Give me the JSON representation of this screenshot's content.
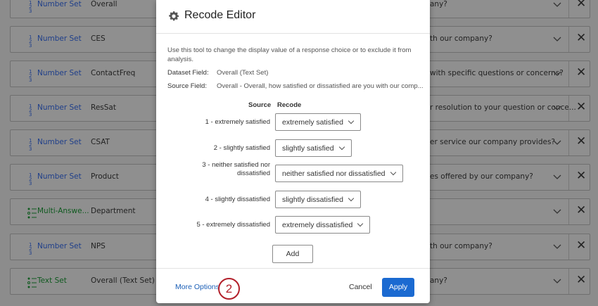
{
  "rows": [
    {
      "type": "Number Set",
      "type_icon": "number-set-icon",
      "field": "Overall",
      "question": "any?",
      "green": false
    },
    {
      "type": "Number Set",
      "type_icon": "number-set-icon",
      "field": "CES",
      "question": "th our company?",
      "green": false
    },
    {
      "type": "Number Set",
      "type_icon": "number-set-icon",
      "field": "ContactFreq",
      "question": "with specific questions or concerns?",
      "green": false
    },
    {
      "type": "Number Set",
      "type_icon": "number-set-icon",
      "field": "ResSat",
      "question": "r resolution to your question or conce...",
      "green": false
    },
    {
      "type": "Number Set",
      "type_icon": "number-set-icon",
      "field": "CSAT",
      "question": "er service our company provides?",
      "green": false
    },
    {
      "type": "Number Set",
      "type_icon": "number-set-icon",
      "field": "Product",
      "question": "es offered by our company?",
      "green": false
    },
    {
      "type": "Multi-Answe...",
      "type_icon": "multi-answer-icon",
      "field": "Department",
      "question": "",
      "green": true
    },
    {
      "type": "Number Set",
      "type_icon": "number-set-icon",
      "field": "NPS",
      "question": "th our company?",
      "green": false
    },
    {
      "type": "Text Set",
      "type_icon": "text-set-icon",
      "field": "Overall (Text Set)",
      "question": "any?",
      "green": true
    }
  ],
  "modal": {
    "title": "Recode Editor",
    "intro": "Use this tool to change the display value of a response choice or to exclude it from analysis.",
    "dataset_label": "Dataset Field:",
    "dataset_value": "Overall (Text Set)",
    "source_label": "Source Field:",
    "source_value": "Overall - Overall, how satisfied or dissatisfied are you with our comp...",
    "col_source": "Source",
    "col_recode": "Recode",
    "recodes": [
      {
        "source": "1 - extremely satisfied",
        "recode": "extremely satisfied"
      },
      {
        "source": "2 - slightly satisfied",
        "recode": "slightly satisfied"
      },
      {
        "source_line1": "3 - neither satisfied nor",
        "source_line2": "dissatisfied",
        "recode": "neither satisfied nor dissatisfied"
      },
      {
        "source": "4 - slightly dissatisfied",
        "recode": "slightly dissatisfied"
      },
      {
        "source": "5 - extremely dissatisfied",
        "recode": "extremely dissatisfied"
      }
    ],
    "add_label": "Add",
    "more_options": "More Options",
    "step_number": "2",
    "cancel_label": "Cancel",
    "apply_label": "Apply"
  },
  "colors": {
    "accent": "#1b6ad1",
    "badge": "#b21f2a",
    "link": "#1b5fb7"
  }
}
